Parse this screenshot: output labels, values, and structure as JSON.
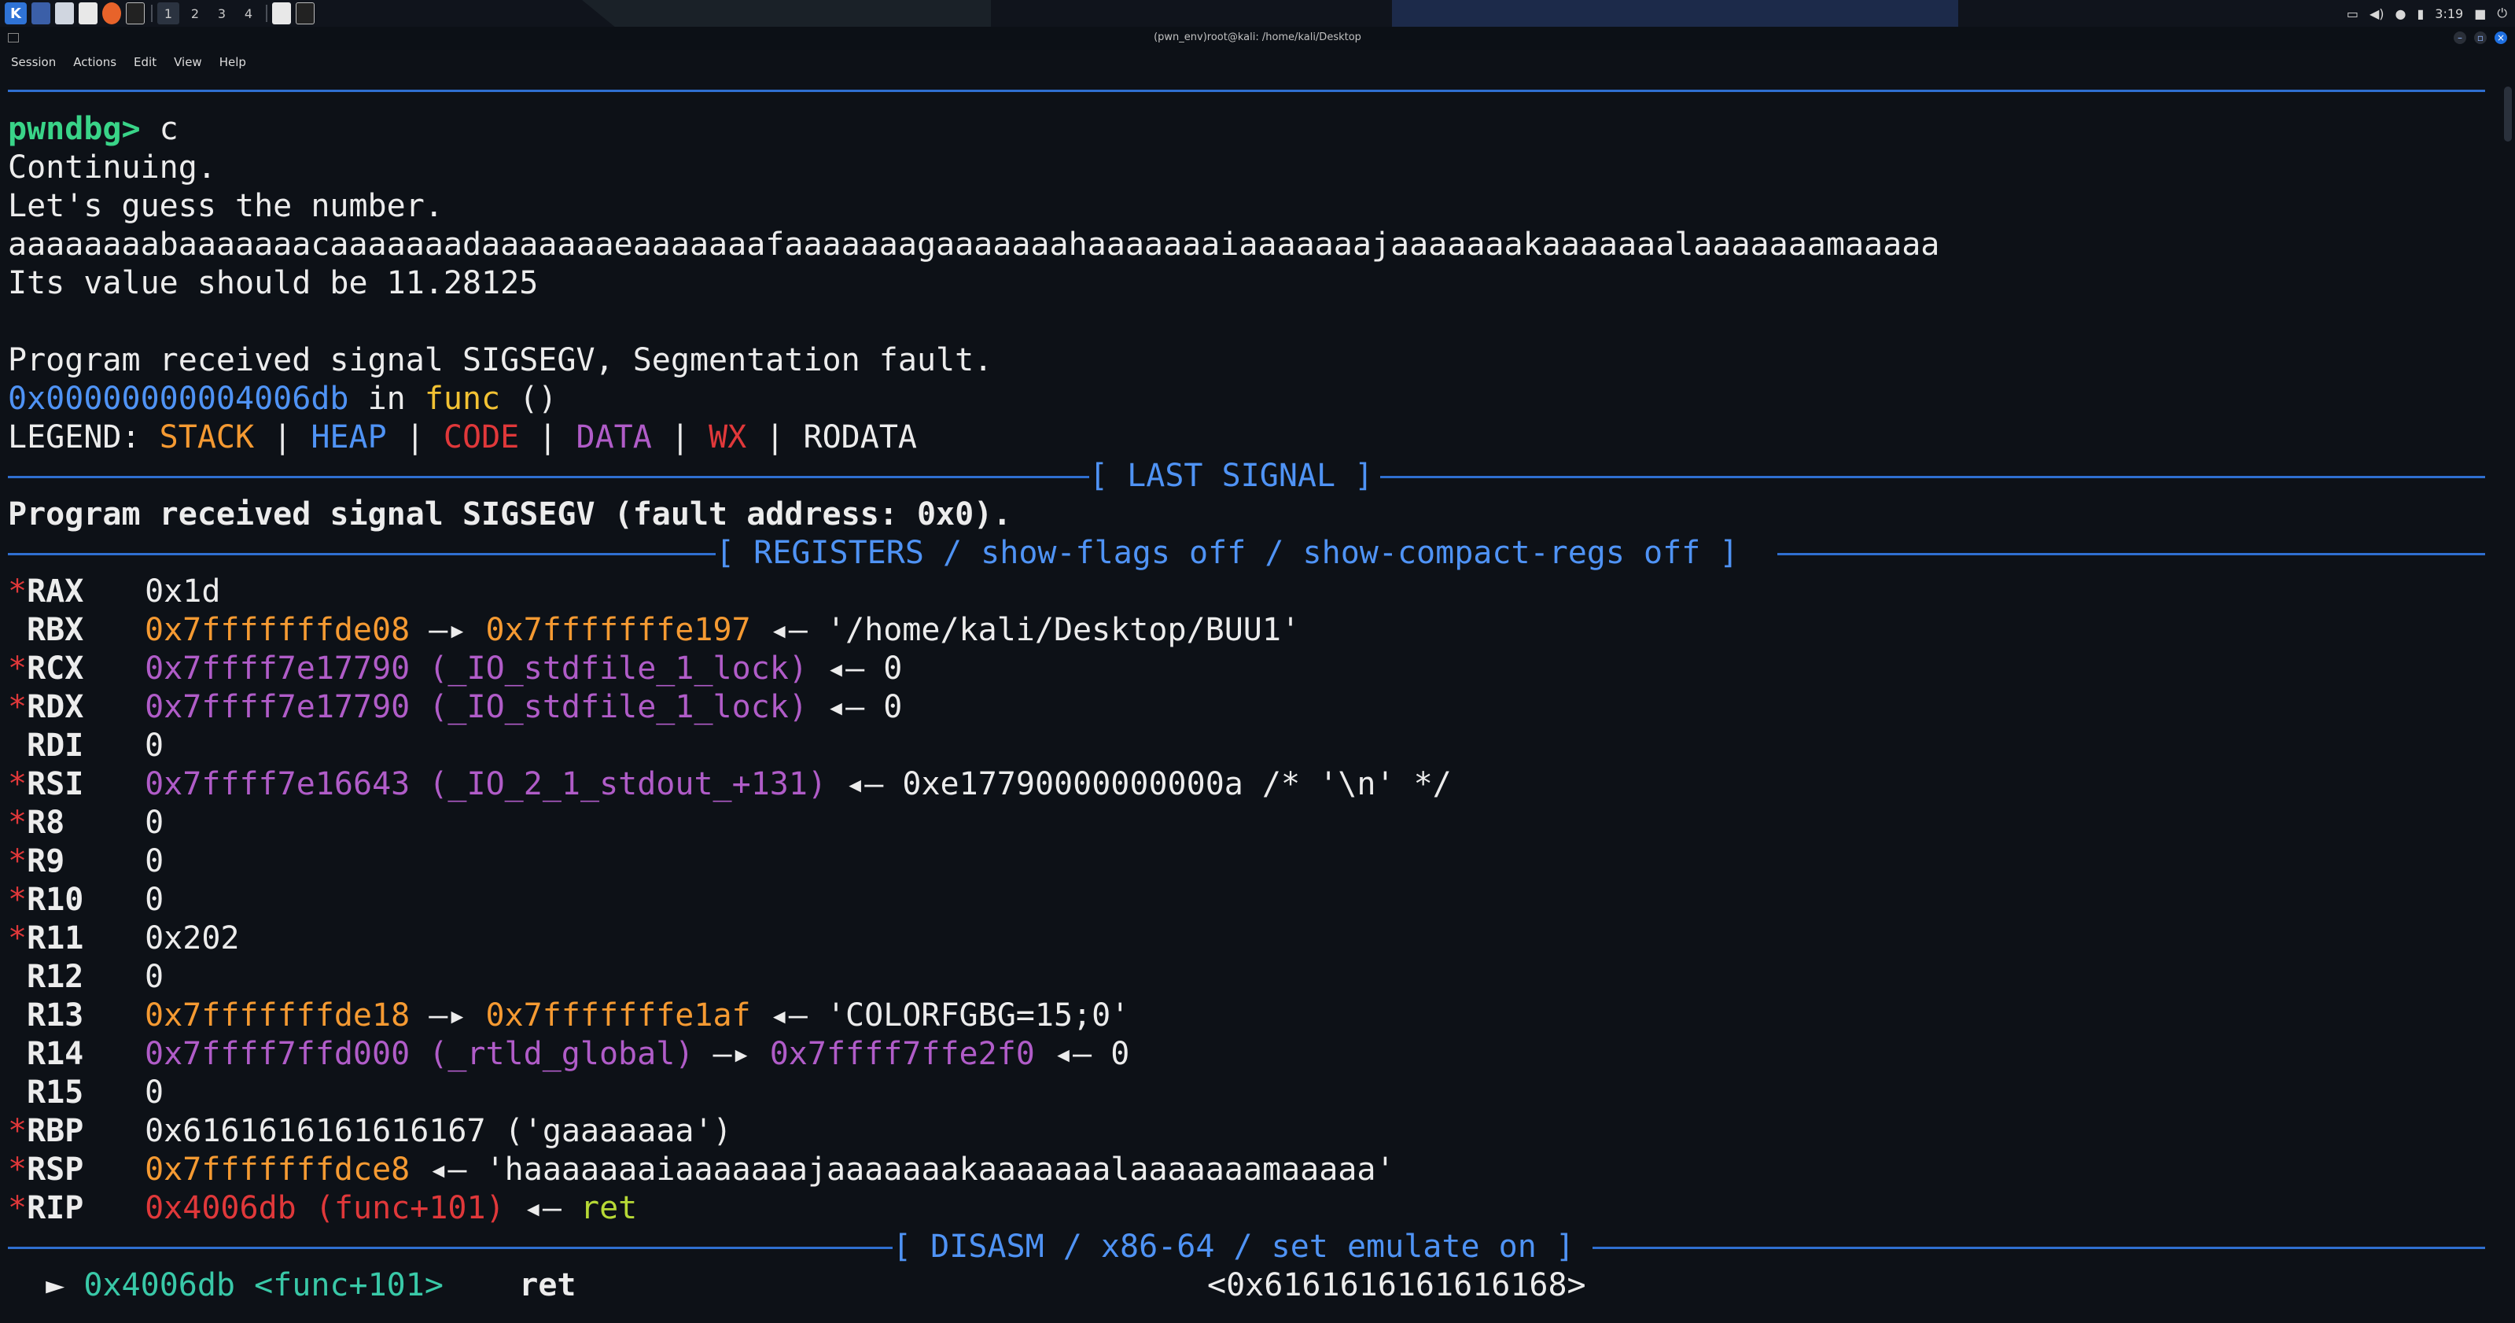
{
  "panel": {
    "workspaces": [
      "1",
      "2",
      "3",
      "4"
    ],
    "clock": "3:19",
    "icons": [
      "kali-menu-icon",
      "desktop-icon",
      "files-icon",
      "text-editor-icon",
      "firefox-icon",
      "terminal-icon"
    ]
  },
  "window": {
    "title": "(pwn_env)root@kali: /home/kali/Desktop"
  },
  "menubar": {
    "items": [
      "Session",
      "Actions",
      "Edit",
      "View",
      "Help"
    ]
  },
  "terminal": {
    "prompt": "pwndbg>",
    "command": "c",
    "continuing": "Continuing.",
    "guess": "Let's guess the number.",
    "payload": "aaaaaaaabaaaaaaacaaaaaaadaaaaaaaeaaaaaaafaaaaaaagaaaaaaahaaaaaaaiaaaaaaajaaaaaaakaaaaaaalaaaaaaamaaaaa",
    "its_value": "Its value should be 11.28125",
    "signal_msg": "Program received signal SIGSEGV, Segmentation fault.",
    "fault_addr": "0x00000000004006db",
    "in_word": " in ",
    "func_name": "func",
    "func_parens": " ()",
    "legend": {
      "label": "LEGEND: ",
      "stack": "STACK",
      "heap": "HEAP",
      "code": "CODE",
      "data": "DATA",
      "wx": "WX",
      "rodata": "RODATA",
      "sep": " | "
    },
    "last_signal_banner": "[ LAST SIGNAL ]",
    "last_signal_msg": "Program received signal SIGSEGV (fault address: 0x0).",
    "registers_banner": "[ REGISTERS / show-flags off / show-compact-regs off ]",
    "disasm_banner": "[ DISASM / x86-64 / set emulate on ]",
    "registers": [
      {
        "star": "*",
        "name": "RAX",
        "parts": [
          {
            "t": "0x1d",
            "c": "white"
          }
        ]
      },
      {
        "star": "",
        "name": "RBX",
        "parts": [
          {
            "t": "0x7fffffffde08",
            "c": "orange"
          },
          {
            "t": " —▸ ",
            "c": "white"
          },
          {
            "t": "0x7fffffffe197",
            "c": "orange"
          },
          {
            "t": " ◂— '/home/kali/Desktop/BUU1'",
            "c": "white"
          }
        ]
      },
      {
        "star": "*",
        "name": "RCX",
        "parts": [
          {
            "t": "0x7ffff7e17790 (_IO_stdfile_1_lock)",
            "c": "purple"
          },
          {
            "t": " ◂— 0",
            "c": "white"
          }
        ]
      },
      {
        "star": "*",
        "name": "RDX",
        "parts": [
          {
            "t": "0x7ffff7e17790 (_IO_stdfile_1_lock)",
            "c": "purple"
          },
          {
            "t": " ◂— 0",
            "c": "white"
          }
        ]
      },
      {
        "star": "",
        "name": "RDI",
        "parts": [
          {
            "t": "0",
            "c": "white"
          }
        ]
      },
      {
        "star": "*",
        "name": "RSI",
        "parts": [
          {
            "t": "0x7ffff7e16643 (_IO_2_1_stdout_+131)",
            "c": "purple"
          },
          {
            "t": " ◂— 0xe17790000000000a /* '\\n' */",
            "c": "white"
          }
        ]
      },
      {
        "star": "*",
        "name": "R8",
        "parts": [
          {
            "t": "0",
            "c": "white"
          }
        ]
      },
      {
        "star": "*",
        "name": "R9",
        "parts": [
          {
            "t": "0",
            "c": "white"
          }
        ]
      },
      {
        "star": "*",
        "name": "R10",
        "parts": [
          {
            "t": "0",
            "c": "white"
          }
        ]
      },
      {
        "star": "*",
        "name": "R11",
        "parts": [
          {
            "t": "0x202",
            "c": "white"
          }
        ]
      },
      {
        "star": "",
        "name": "R12",
        "parts": [
          {
            "t": "0",
            "c": "white"
          }
        ]
      },
      {
        "star": "",
        "name": "R13",
        "parts": [
          {
            "t": "0x7fffffffde18",
            "c": "orange"
          },
          {
            "t": " —▸ ",
            "c": "white"
          },
          {
            "t": "0x7fffffffe1af",
            "c": "orange"
          },
          {
            "t": " ◂— 'COLORFGBG=15;0'",
            "c": "white"
          }
        ]
      },
      {
        "star": "",
        "name": "R14",
        "parts": [
          {
            "t": "0x7ffff7ffd000 (_rtld_global)",
            "c": "purple"
          },
          {
            "t": " —▸ ",
            "c": "white"
          },
          {
            "t": "0x7ffff7ffe2f0",
            "c": "purple"
          },
          {
            "t": " ◂— 0",
            "c": "white"
          }
        ]
      },
      {
        "star": "",
        "name": "R15",
        "parts": [
          {
            "t": "0",
            "c": "white"
          }
        ]
      },
      {
        "star": "*",
        "name": "RBP",
        "parts": [
          {
            "t": "0x6161616161616167 ('gaaaaaaa')",
            "c": "white"
          }
        ]
      },
      {
        "star": "*",
        "name": "RSP",
        "parts": [
          {
            "t": "0x7fffffffdce8",
            "c": "orange"
          },
          {
            "t": " ◂— 'haaaaaaaiaaaaaaajaaaaaaakaaaaaaalaaaaaaamaaaaa'",
            "c": "white"
          }
        ]
      },
      {
        "star": "*",
        "name": "RIP",
        "parts": [
          {
            "t": "0x4006db (func+101)",
            "c": "red"
          },
          {
            "t": " ◂— ",
            "c": "white"
          },
          {
            "t": "ret",
            "c": "lime"
          }
        ]
      }
    ],
    "disasm": {
      "arrow": "►",
      "addr": "0x4006db <func+101>",
      "mnemonic": "ret",
      "target": "<0x6161616161616168>"
    }
  }
}
